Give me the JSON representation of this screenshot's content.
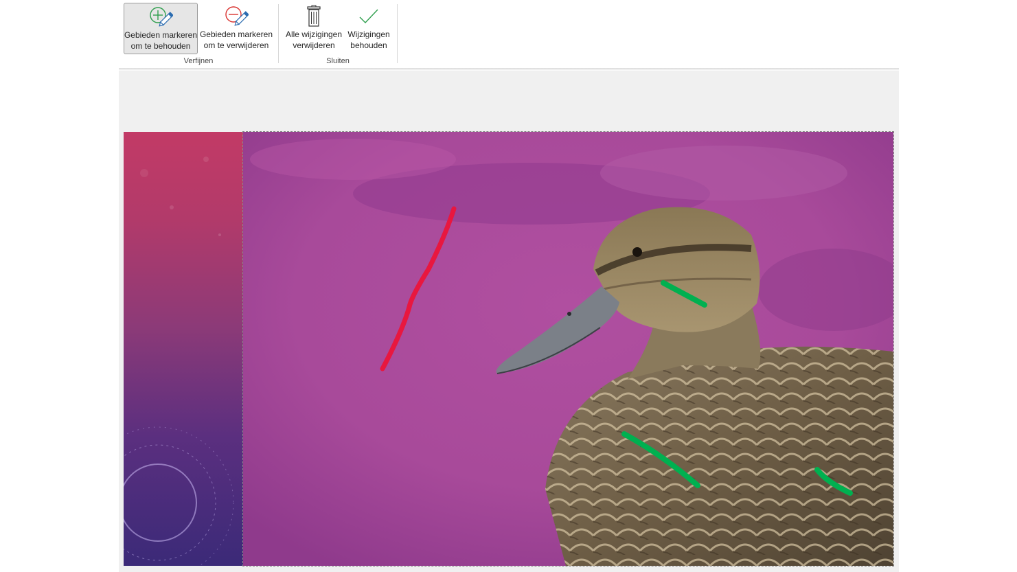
{
  "ribbon": {
    "refine_group": {
      "label": "Verfijnen",
      "mark_keep": {
        "line1": "Gebieden markeren",
        "line2": "om te behouden",
        "icon": "pencil-plus-icon",
        "active": true
      },
      "mark_remove": {
        "line1": "Gebieden markeren",
        "line2": "om te verwijderen",
        "icon": "pencil-minus-icon"
      }
    },
    "close_group": {
      "label": "Sluiten",
      "discard": {
        "line1": "Alle wijzigingen",
        "line2": "verwijderen",
        "icon": "trash-icon"
      },
      "keep": {
        "line1": "Wijzigingen",
        "line2": "behouden",
        "icon": "checkmark-icon"
      }
    }
  },
  "canvas": {
    "background_removal_color": "#a64797",
    "keep_stroke_color": "#00b050",
    "remove_stroke_color": "#e8173f",
    "subject": "duck-photo"
  }
}
